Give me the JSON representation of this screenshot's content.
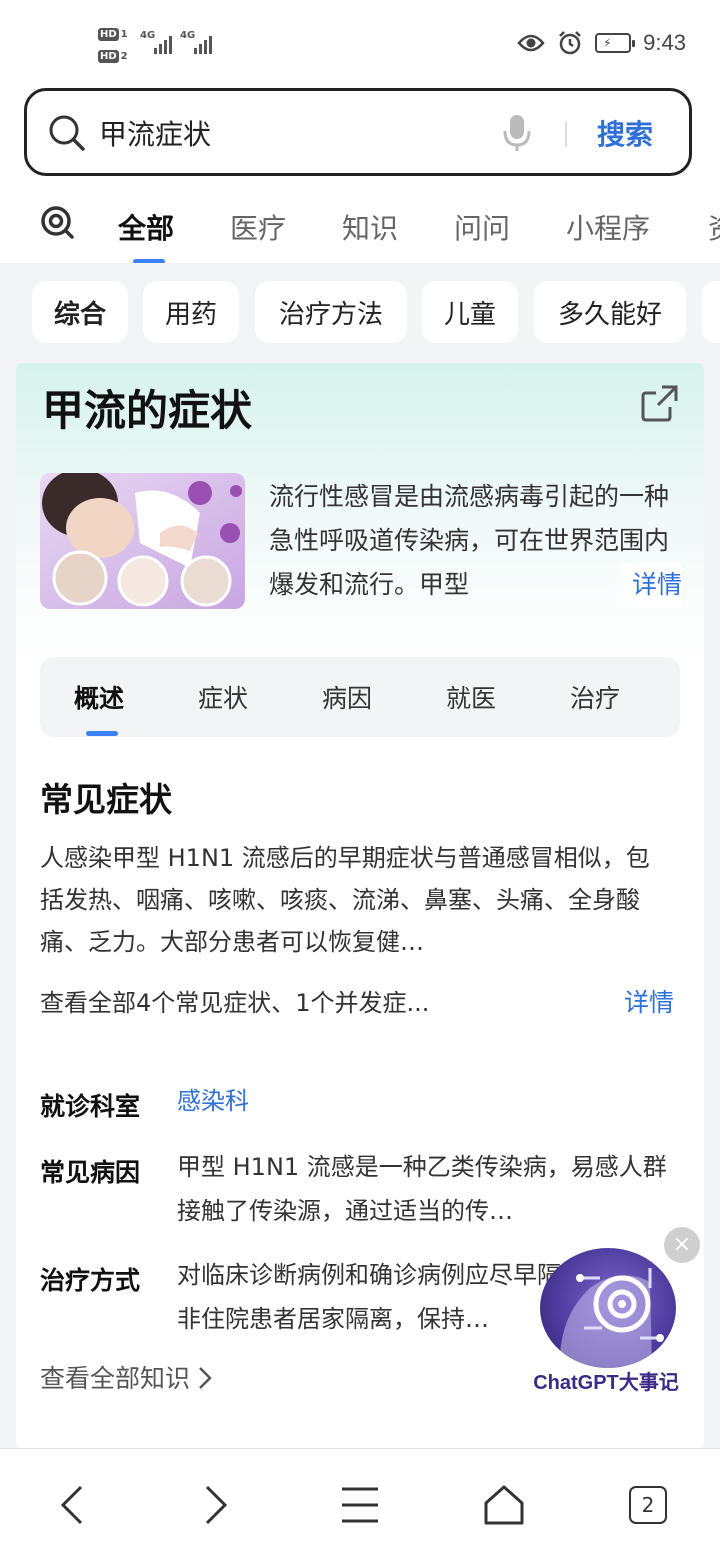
{
  "status_bar": {
    "sim1": "HD",
    "sim1_num": "1",
    "sim2": "HD",
    "sim2_num": "2",
    "network1": "4G",
    "network2": "4G",
    "time": "9:43",
    "icons": [
      "eye-icon",
      "alarm-icon",
      "battery-charging-icon"
    ]
  },
  "search": {
    "query": "甲流症状",
    "button_label": "搜索"
  },
  "category_tabs": [
    {
      "label": "全部",
      "active": true
    },
    {
      "label": "医疗",
      "active": false
    },
    {
      "label": "知识",
      "active": false
    },
    {
      "label": "问问",
      "active": false
    },
    {
      "label": "小程序",
      "active": false
    },
    {
      "label": "资",
      "active": false
    }
  ],
  "chips": [
    {
      "label": "综合",
      "active": true
    },
    {
      "label": "用药",
      "active": false
    },
    {
      "label": "治疗方法",
      "active": false
    },
    {
      "label": "儿童",
      "active": false
    },
    {
      "label": "多久能好",
      "active": false
    }
  ],
  "card": {
    "title": "甲流的症状",
    "intro": "流行性感冒是由流感病毒引起的一种急性呼吸道传染病，可在世界范围内爆发和流行。甲型",
    "intro_more": "详情",
    "image_label": "H1N1",
    "sub_tabs": [
      {
        "label": "概述",
        "active": true
      },
      {
        "label": "症状",
        "active": false
      },
      {
        "label": "病因",
        "active": false
      },
      {
        "label": "就医",
        "active": false
      },
      {
        "label": "治疗",
        "active": false
      }
    ],
    "section_title": "常见症状",
    "section_body": "人感染甲型 H1N1 流感后的早期症状与普通感冒相似，包括发热、咽痛、咳嗽、咳痰、流涕、鼻塞、头痛、全身酸痛、乏力。大部分患者可以恢复健…",
    "section_summary": "查看全部4个常见症状、1个并发症...",
    "section_more": "详情",
    "info": [
      {
        "label": "就诊科室",
        "value": "感染科"
      },
      {
        "label": "常见病因",
        "value": "甲型 H1N1 流感是一种乙类传染病，易感人群接触了传染源，通过适当的传…"
      },
      {
        "label": "治疗方式",
        "value": "对临床诊断病例和确诊病例应尽早隔离治疗。非住院患者居家隔离，保持…"
      }
    ],
    "all_knowledge": "查看全部知识"
  },
  "float_ad": {
    "text": "ChatGPT大事记",
    "close": "×"
  },
  "bottom_nav": {
    "tab_count": "2"
  }
}
